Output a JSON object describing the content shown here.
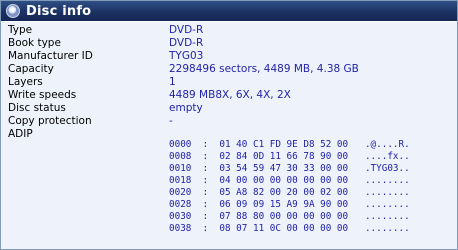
{
  "window": {
    "title": "Disc info",
    "title_icon": "disc-info-icon"
  },
  "colors": {
    "titlebar": "#1c3262",
    "value_text": "#2323a8",
    "panel_bg": "#eef3fb"
  },
  "fields": [
    {
      "label": "Type",
      "value": "DVD-R"
    },
    {
      "label": "Book type",
      "value": "DVD-R"
    },
    {
      "label": "Manufacturer ID",
      "value": "TYG03"
    },
    {
      "label": "Capacity",
      "value": "2298496 sectors, 4489 MB, 4.38 GB"
    },
    {
      "label": "Layers",
      "value": "1"
    },
    {
      "label": "Write speeds",
      "value": "4489 MB8X, 6X, 4X, 2X"
    },
    {
      "label": "Disc status",
      "value": "empty"
    },
    {
      "label": "Copy protection",
      "value": "-"
    },
    {
      "label": "ADIP",
      "value": ""
    }
  ],
  "adip_dump": [
    {
      "offset": "0000",
      "bytes": "01 40 C1 FD 9E D8 52 00",
      "ascii": ".@....R."
    },
    {
      "offset": "0008",
      "bytes": "02 84 0D 11 66 78 90 00",
      "ascii": "....fx.."
    },
    {
      "offset": "0010",
      "bytes": "03 54 59 47 30 33 00 00",
      "ascii": ".TYG03.."
    },
    {
      "offset": "0018",
      "bytes": "04 00 00 00 00 00 00 00",
      "ascii": "........"
    },
    {
      "offset": "0020",
      "bytes": "05 A8 82 00 20 00 02 00",
      "ascii": "........"
    },
    {
      "offset": "0028",
      "bytes": "06 09 09 15 A9 9A 90 00",
      "ascii": "........"
    },
    {
      "offset": "0030",
      "bytes": "07 88 80 00 00 00 00 00",
      "ascii": "........"
    },
    {
      "offset": "0038",
      "bytes": "08 07 11 0C 00 00 00 00",
      "ascii": "........"
    }
  ]
}
